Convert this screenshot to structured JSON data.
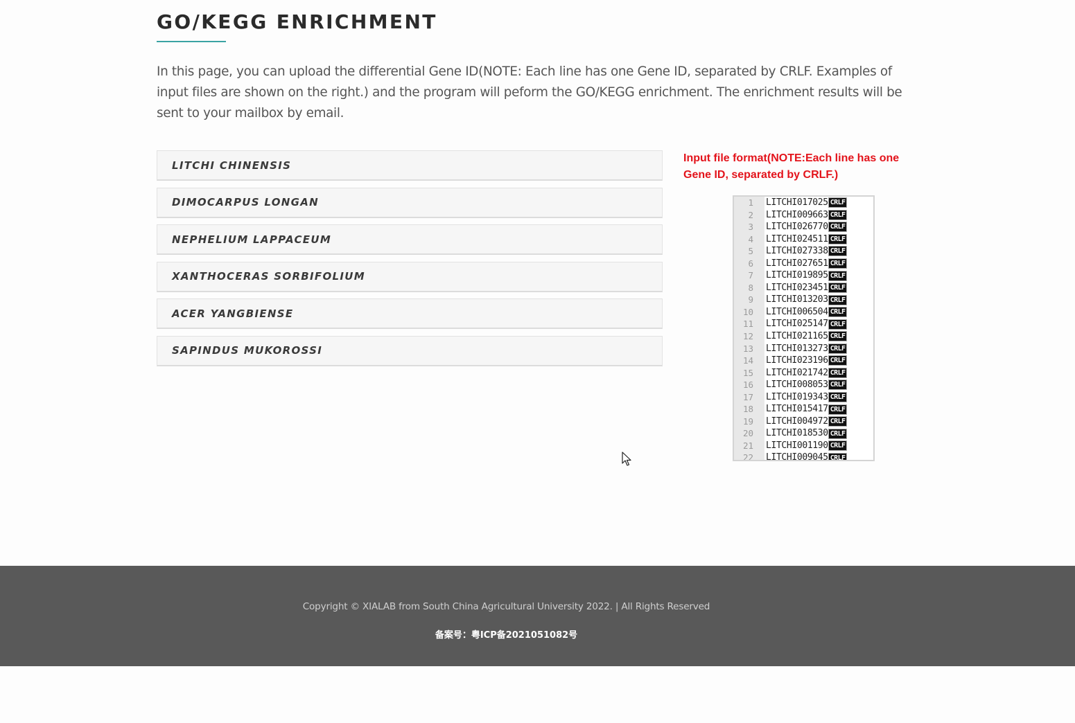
{
  "header": {
    "title": "GO/KEGG ENRICHMENT",
    "intro": "In this page, you can upload the differential Gene ID(NOTE: Each line has one Gene ID, separated by CRLF. Examples of input files are shown on the right.) and the program will peform the GO/KEGG enrichment. The enrichment results will be sent to your mailbox by email."
  },
  "species": [
    {
      "label": "LITCHI CHINENSIS"
    },
    {
      "label": "DIMOCARPUS LONGAN"
    },
    {
      "label": "NEPHELIUM LAPPACEUM"
    },
    {
      "label": "XANTHOCERAS SORBIFOLIUM"
    },
    {
      "label": "ACER YANGBIENSE"
    },
    {
      "label": "SAPINDUS MUKOROSSI"
    }
  ],
  "format_panel": {
    "note": "Input file format(NOTE:Each line has one Gene ID, separated by CRLF.)",
    "line_ending": "CRLF",
    "lines": [
      {
        "n": "1",
        "id": "LITCHI017025"
      },
      {
        "n": "2",
        "id": "LITCHI009663"
      },
      {
        "n": "3",
        "id": "LITCHI026770"
      },
      {
        "n": "4",
        "id": "LITCHI024511"
      },
      {
        "n": "5",
        "id": "LITCHI027338"
      },
      {
        "n": "6",
        "id": "LITCHI027651"
      },
      {
        "n": "7",
        "id": "LITCHI019895"
      },
      {
        "n": "8",
        "id": "LITCHI023451"
      },
      {
        "n": "9",
        "id": "LITCHI013203"
      },
      {
        "n": "10",
        "id": "LITCHI006504"
      },
      {
        "n": "11",
        "id": "LITCHI025147"
      },
      {
        "n": "12",
        "id": "LITCHI021165"
      },
      {
        "n": "13",
        "id": "LITCHI013273"
      },
      {
        "n": "14",
        "id": "LITCHI023196"
      },
      {
        "n": "15",
        "id": "LITCHI021742"
      },
      {
        "n": "16",
        "id": "LITCHI008053"
      },
      {
        "n": "17",
        "id": "LITCHI019343"
      },
      {
        "n": "18",
        "id": "LITCHI015417"
      },
      {
        "n": "19",
        "id": "LITCHI004972"
      },
      {
        "n": "20",
        "id": "LITCHI018530"
      },
      {
        "n": "21",
        "id": "LITCHI001190"
      },
      {
        "n": "22",
        "id": "LITCHI009045"
      }
    ]
  },
  "footer": {
    "copyright": "Copyright © XIALAB from South China Agricultural University 2022. | All Rights Reserved",
    "icp": "备案号：粤ICP备2021051082号"
  },
  "colors": {
    "accent": "#3aa3a3",
    "note_red": "#e3131b",
    "footer_bg": "#595959"
  },
  "icons": {
    "cursor": "mouse-pointer-icon"
  }
}
